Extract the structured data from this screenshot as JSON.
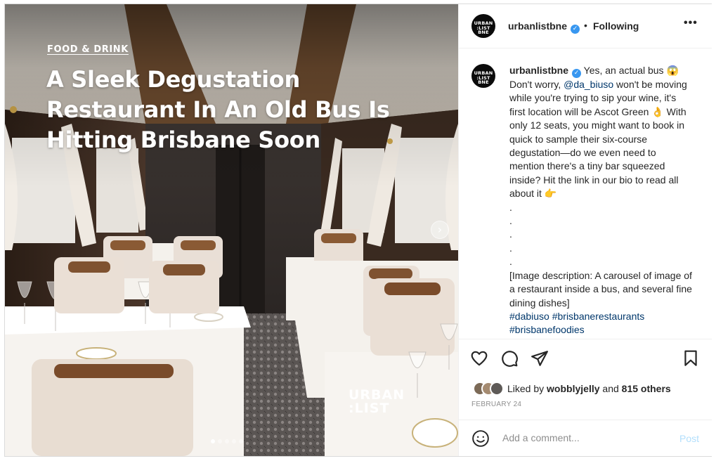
{
  "media": {
    "category": "FOOD & DRINK",
    "headline": "A Sleek Degustation Restaurant In An Old Bus Is Hitting Brisbane Soon",
    "brand_line1": "URBAN",
    "brand_line2": ":LIST",
    "next_icon": "chevron-right-icon",
    "carousel_dots": 5,
    "active_dot": 1
  },
  "header": {
    "avatar_text_1": "URBAN",
    "avatar_text_2": ":LIST",
    "avatar_text_3": "BNE",
    "username": "urbanlistbne",
    "separator": "•",
    "follow_status": "Following",
    "more_icon": "more-horizontal-icon"
  },
  "caption": {
    "username": "urbanlistbne",
    "text_1": "Yes, an actual bus 😱 Don't worry, ",
    "mention": "@da_biuso",
    "text_2": " won't be moving while you're trying to sip your wine, it's first location will be Ascot Green 👌 With only 12 seats, you might want to book in quick to sample their six-course degustation—do we even need to mention there's a tiny bar squeezed inside? Hit the link in our bio to read all about it 👉",
    "dots": [
      ".",
      ".",
      ".",
      ".",
      "."
    ],
    "image_description": "[Image description: A carousel of image of a restaurant inside a bus, and several fine dining dishes]",
    "hashtags_line1": "#dabiuso #brisbanerestaurants",
    "hashtags_line2": "#brisbanefoodies"
  },
  "actions": {
    "like_icon": "heart-icon",
    "comment_icon": "comment-icon",
    "share_icon": "send-icon",
    "save_icon": "bookmark-icon"
  },
  "likes": {
    "prefix": "Liked by",
    "user": "wobblyjelly",
    "middle": "and",
    "others": "815 others"
  },
  "date": "FEBRUARY 24",
  "comment": {
    "placeholder": "Add a comment...",
    "post_label": "Post",
    "emoji_icon": "smiley-icon"
  },
  "colors": {
    "verified": "#3897f0",
    "link": "#00376b",
    "post_disabled": "#b2dffc",
    "muted": "#8e8e8e"
  }
}
